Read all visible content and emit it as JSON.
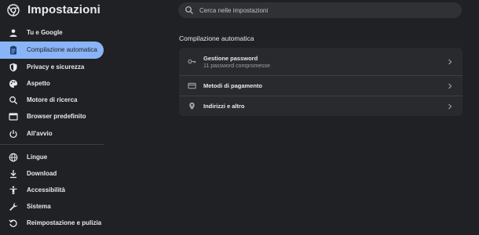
{
  "app": {
    "title": "Impostazioni",
    "logo_icon": "chrome-logo-icon"
  },
  "search": {
    "placeholder": "Cerca nelle impostazioni",
    "value": ""
  },
  "sidebar": {
    "active_color": "#8ab4f8",
    "items": [
      {
        "label": "Tu e Google",
        "icon": "person-icon"
      },
      {
        "label": "Compilazione automatica",
        "icon": "clipboard-icon",
        "active": true
      },
      {
        "label": "Privacy e sicurezza",
        "icon": "shield-icon"
      },
      {
        "label": "Aspetto",
        "icon": "palette-icon"
      },
      {
        "label": "Motore di ricerca",
        "icon": "search-icon"
      },
      {
        "label": "Browser predefinito",
        "icon": "browser-icon"
      },
      {
        "label": "All'avvio",
        "icon": "power-icon"
      },
      {
        "label": "Lingue",
        "icon": "globe-icon"
      },
      {
        "label": "Download",
        "icon": "download-icon"
      },
      {
        "label": "Accessibilità",
        "icon": "accessibility-icon"
      },
      {
        "label": "Sistema",
        "icon": "wrench-icon"
      },
      {
        "label": "Reimpostazione e pulizia",
        "icon": "reset-icon"
      }
    ]
  },
  "main": {
    "section_title": "Compilazione automatica",
    "rows": [
      {
        "title": "Gestione password",
        "subtitle": "11 password compromesse",
        "icon": "key-icon"
      },
      {
        "title": "Metodi di pagamento",
        "subtitle": "",
        "icon": "credit-card-icon"
      },
      {
        "title": "Indirizzi e altro",
        "subtitle": "",
        "icon": "location-pin-icon"
      }
    ]
  }
}
